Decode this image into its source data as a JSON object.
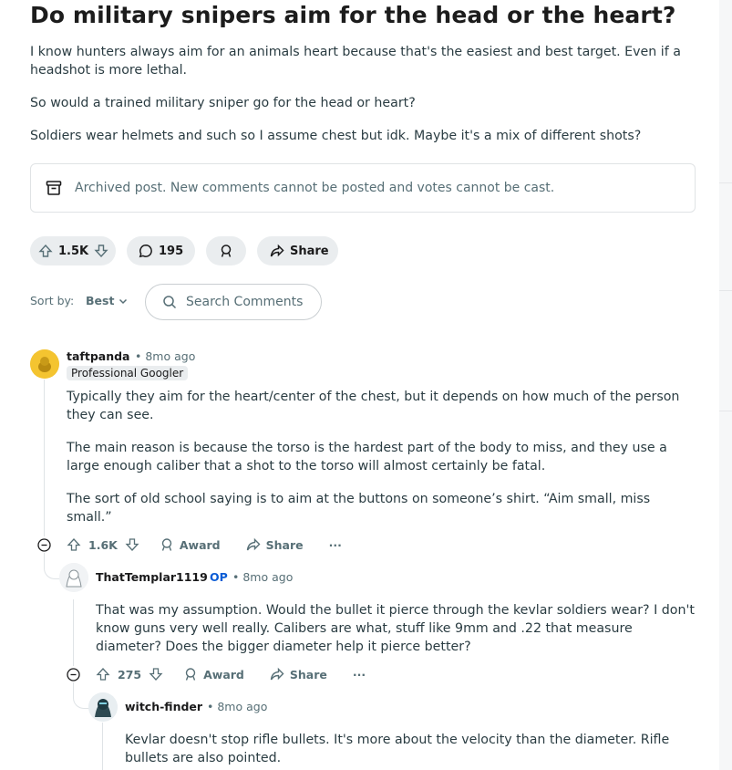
{
  "post": {
    "title": "Do military snipers aim for the head or the heart?",
    "body": [
      "I know hunters always aim for an animals heart because that's the easiest and best target. Even if a headshot is more lethal.",
      "So would a trained military sniper go for the head or heart?",
      "Soldiers wear helmets and such so I assume chest but idk. Maybe it's a mix of different shots?"
    ],
    "archived_notice": "Archived post. New comments cannot be posted and votes cannot be cast.",
    "votes": "1.5K",
    "comments_count": "195",
    "share_label": "Share"
  },
  "sort": {
    "label": "Sort by:",
    "value": "Best",
    "search_placeholder": "Search Comments"
  },
  "comments": [
    {
      "author": "taftpanda",
      "time": "8mo ago",
      "flair": "Professional Googler",
      "op": "",
      "body": [
        "Typically they aim for the heart/center of the chest, but it depends on how much of the person they can see.",
        "The main reason is because the torso is the hardest part of the body to miss, and they use a large enough caliber that a shot to the torso will almost certainly be fatal.",
        "The sort of old school saying is to aim at the buttons on someone’s shirt. “Aim small, miss small.”"
      ],
      "votes": "1.6K",
      "award_label": "Award",
      "share_label": "Share",
      "more_label": "···"
    },
    {
      "author": "ThatTemplar1119",
      "time": "8mo ago",
      "op": "OP",
      "body": [
        "That was my assumption. Would the bullet it pierce through the kevlar soldiers wear? I don't know guns very well really. Calibers are what, stuff like 9mm and .22 that measure diameter? Does the bigger diameter help it pierce better?"
      ],
      "votes": "275",
      "award_label": "Award",
      "share_label": "Share",
      "more_label": "···"
    },
    {
      "author": "witch-finder",
      "time": "8mo ago",
      "op": "",
      "body": [
        "Kevlar doesn't stop rifle bullets. It's more about the velocity than the diameter. Rifle bullets are also pointed."
      ]
    }
  ],
  "separator": "•",
  "colors": {
    "accent_op": "#0a5cd5",
    "pill_bg": "#eaedef",
    "text_meta": "#576f76"
  }
}
